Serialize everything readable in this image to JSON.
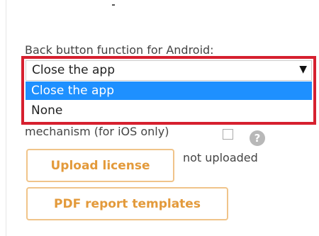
{
  "settings": {
    "back_button_label": "Back button function for Android:",
    "back_button_select": {
      "selected_value": "Close the app",
      "options": [
        "Close the app",
        "None"
      ]
    },
    "ios_mechanism_label": "mechanism (for iOS only)",
    "ios_mechanism_checked": false,
    "help_glyph": "?",
    "license_status": "not uploaded",
    "upload_license_label": "Upload license",
    "pdf_templates_label": "PDF report templates"
  },
  "colors": {
    "highlight_border": "#d6202f",
    "selected_option_bg": "#1e90ff",
    "button_text": "#e39a3b",
    "button_border": "#f0c48a"
  },
  "icons": {
    "dropdown_arrow": "caret-down-icon",
    "help": "help-icon"
  }
}
